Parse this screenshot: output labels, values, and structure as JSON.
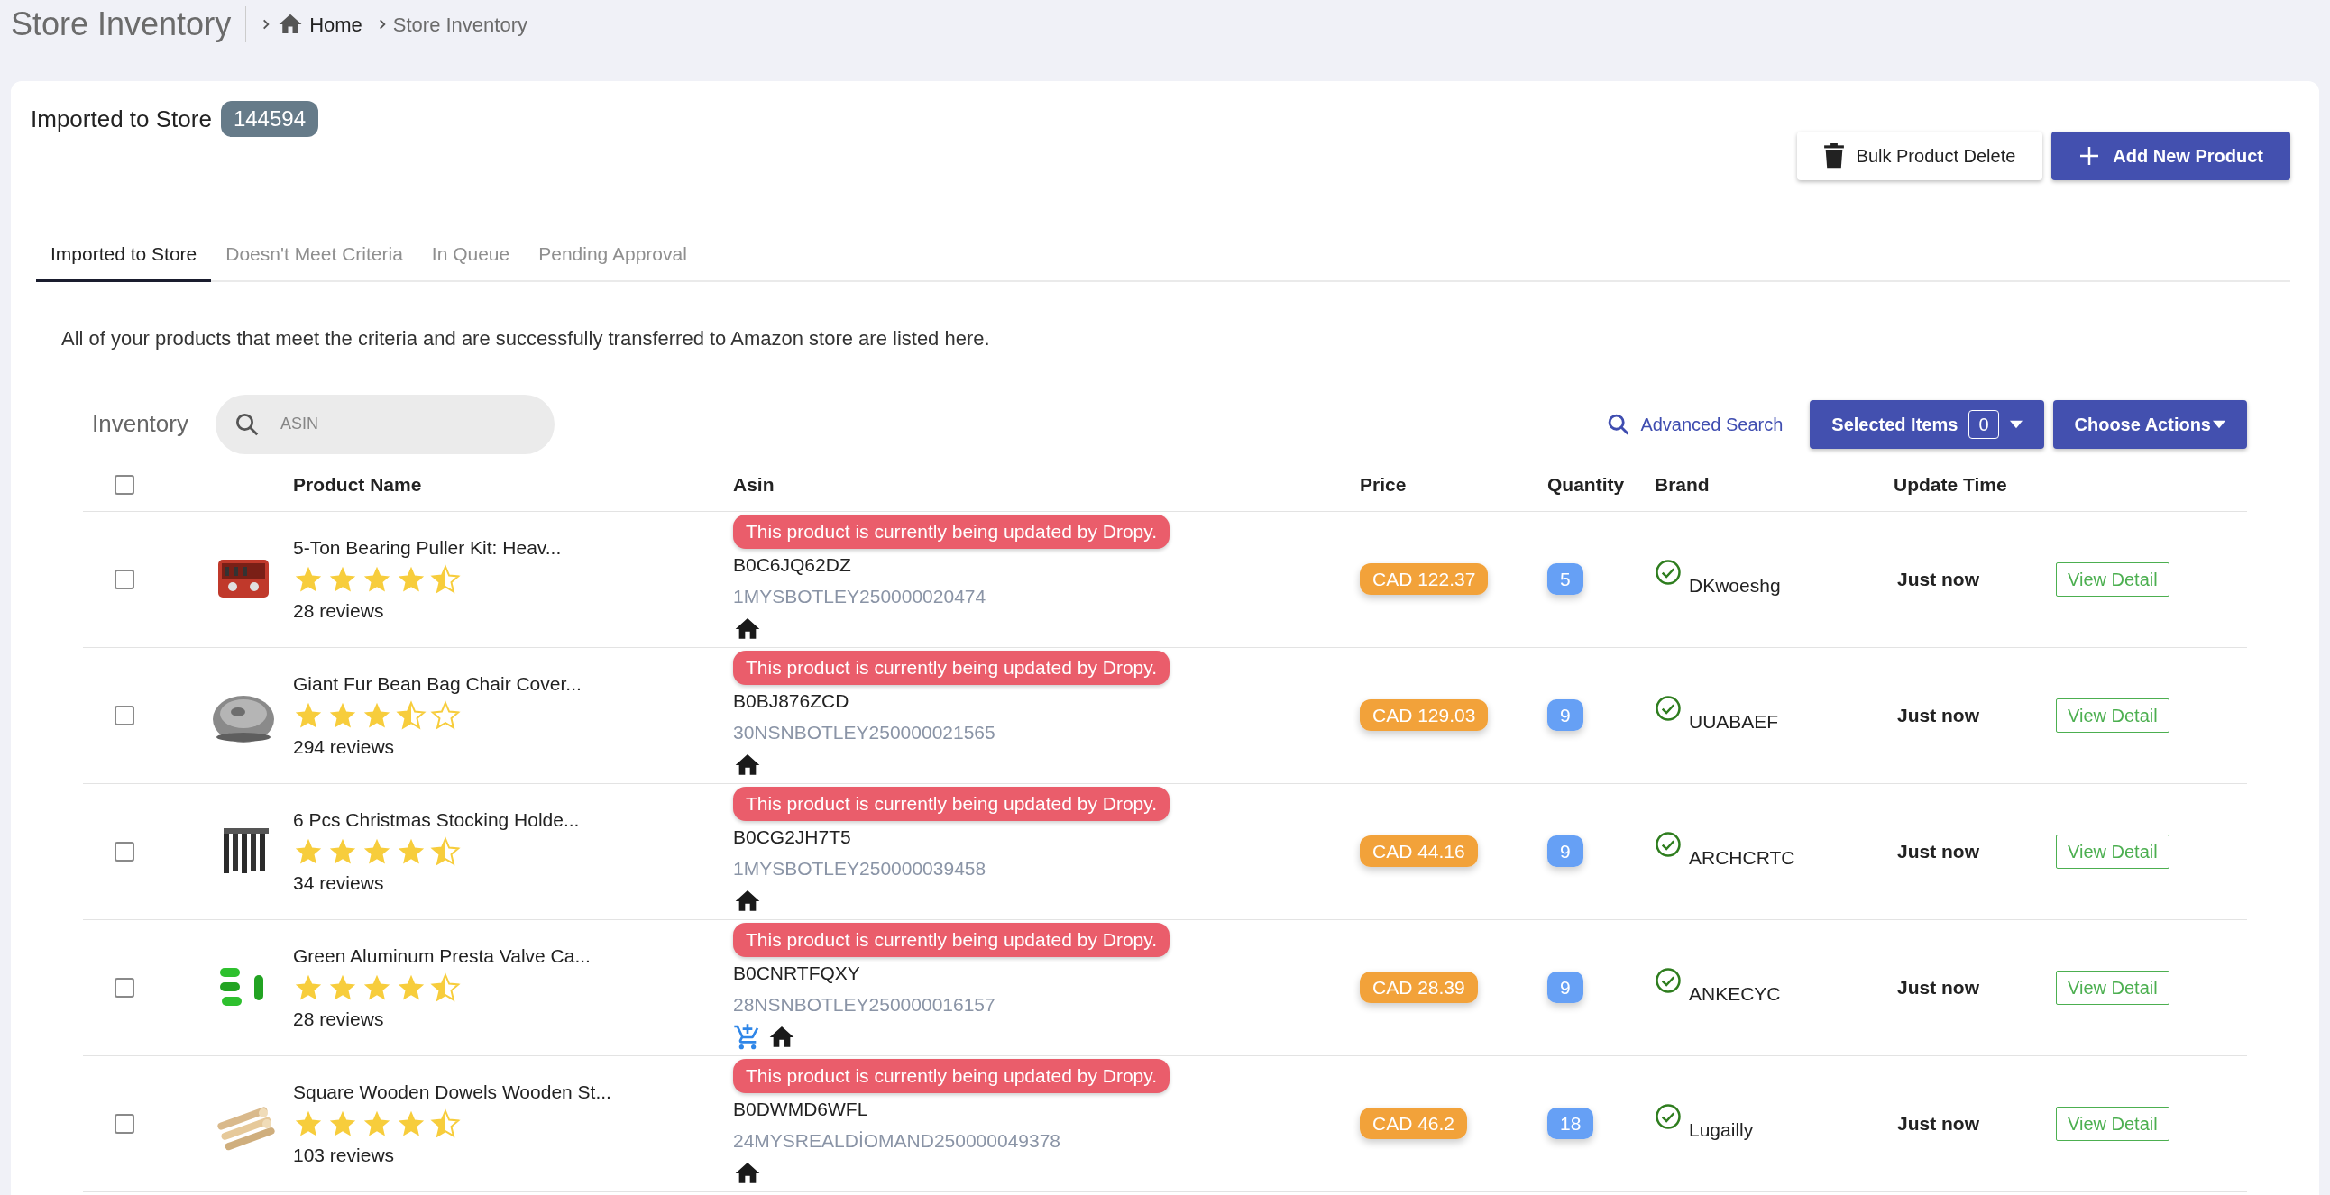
{
  "header": {
    "title": "Store Inventory",
    "breadcrumb": [
      {
        "label": "Home",
        "kind": "home"
      },
      {
        "label": "Store Inventory",
        "kind": "plain"
      }
    ]
  },
  "card": {
    "title": "Imported to Store",
    "count": "144594",
    "actions": [
      {
        "label": "Bulk Product Delete",
        "kind": "delete"
      },
      {
        "label": "Add New Product",
        "kind": "add"
      }
    ]
  },
  "tabs": [
    {
      "label": "Imported to Store",
      "selected": true
    },
    {
      "label": "Doesn't Meet Criteria",
      "selected": false
    },
    {
      "label": "In Queue",
      "selected": false
    },
    {
      "label": "Pending Approval",
      "selected": false
    }
  ],
  "description": "All of your products that meet the criteria and are successfully transferred to Amazon store are listed here.",
  "toolbar": {
    "title": "Inventory",
    "search": {
      "placeholder": "ASIN"
    },
    "advanced_search": "Advanced Search",
    "selected_items": {
      "label": "Selected Items",
      "count": "0"
    },
    "choose_actions": "Choose Actions"
  },
  "table": {
    "select_all": {
      "checked": false
    },
    "columns": [
      "Product Name",
      "Asin",
      "Price",
      "Quantity",
      "Brand",
      "Update Time"
    ],
    "rows": [
      {
        "checked": false,
        "name": "5-Ton Bearing Puller Kit: Heav...",
        "stars": 4.5,
        "reviews": "28 reviews",
        "notice": "This product is currently being updated by Dropy.",
        "asin": "B0C6JQ62DZ",
        "sku": "1MYSBOTLEY250000020474",
        "badges": [
          {
            "kind": "home"
          }
        ],
        "price": "CAD 122.37",
        "quantity": "5",
        "brand": "DKwoeshg",
        "verified": true,
        "updated": "Just now",
        "action": "View Detail"
      },
      {
        "checked": false,
        "name": "Giant Fur Bean Bag Chair Cover...",
        "stars": 3.5,
        "reviews": "294 reviews",
        "notice": "This product is currently being updated by Dropy.",
        "asin": "B0BJ876ZCD",
        "sku": "30NSNBOTLEY250000021565",
        "badges": [
          {
            "kind": "home"
          }
        ],
        "price": "CAD 129.03",
        "quantity": "9",
        "brand": "UUABAEF",
        "verified": true,
        "updated": "Just now",
        "action": "View Detail"
      },
      {
        "checked": false,
        "name": "6 Pcs Christmas Stocking Holde...",
        "stars": 4.5,
        "reviews": "34 reviews",
        "notice": "This product is currently being updated by Dropy.",
        "asin": "B0CG2JH7T5",
        "sku": "1MYSBOTLEY250000039458",
        "badges": [
          {
            "kind": "home"
          }
        ],
        "price": "CAD 44.16",
        "quantity": "9",
        "brand": "ARCHCRTC",
        "verified": true,
        "updated": "Just now",
        "action": "View Detail"
      },
      {
        "checked": false,
        "name": "Green Aluminum Presta Valve Ca...",
        "stars": 4.5,
        "reviews": "28 reviews",
        "notice": "This product is currently being updated by Dropy.",
        "asin": "B0CNRTFQXY",
        "sku": "28NSNBOTLEY250000016157",
        "badges": [
          {
            "kind": "cart"
          },
          {
            "kind": "home"
          }
        ],
        "price": "CAD 28.39",
        "quantity": "9",
        "brand": "ANKECYC",
        "verified": true,
        "updated": "Just now",
        "action": "View Detail"
      },
      {
        "checked": false,
        "name": "Square Wooden Dowels Wooden St...",
        "stars": 4.5,
        "reviews": "103 reviews",
        "notice": "This product is currently being updated by Dropy.",
        "asin": "B0DWMD6WFL",
        "sku": "24MYSREALDİOMAND250000049378",
        "badges": [
          {
            "kind": "home"
          }
        ],
        "price": "CAD 46.2",
        "quantity": "18",
        "brand": "Lugailly",
        "verified": true,
        "updated": "Just now",
        "action": "View Detail"
      }
    ]
  }
}
